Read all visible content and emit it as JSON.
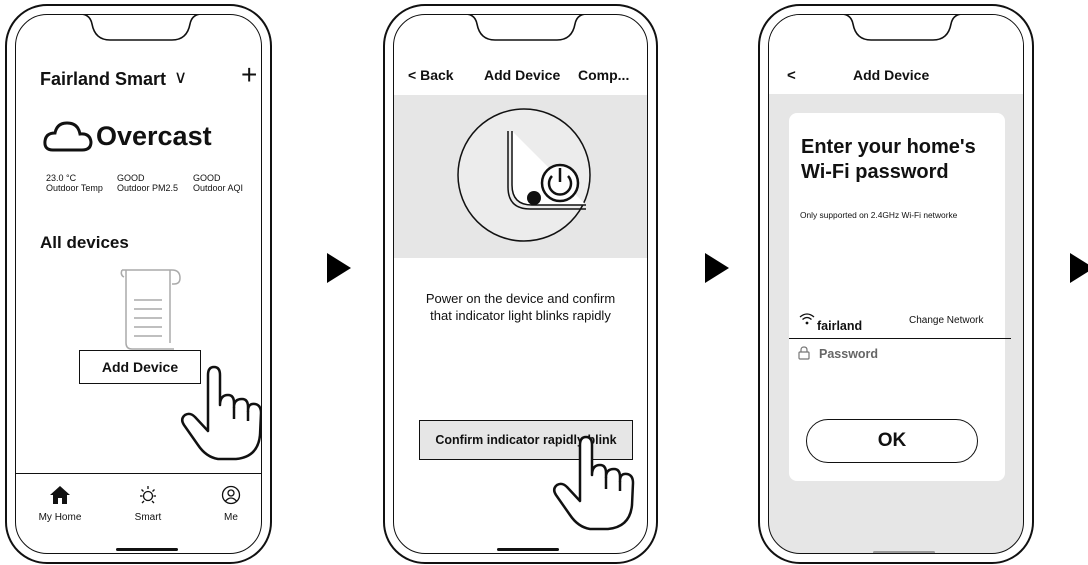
{
  "screen1": {
    "home_name": "Fairland Smart",
    "dropdown_glyph": "∨",
    "add_glyph": "+",
    "weather": "Overcast",
    "stats": [
      {
        "value": "23.0 °C",
        "label": "Outdoor Temp"
      },
      {
        "value": "GOOD",
        "label": "Outdoor PM2.5"
      },
      {
        "value": "GOOD",
        "label": "Outdoor AQI"
      }
    ],
    "section_title": "All devices",
    "add_device_label": "Add Device",
    "tabs": [
      {
        "label": "My Home",
        "icon": "home-icon"
      },
      {
        "label": "Smart",
        "icon": "sun-icon"
      },
      {
        "label": "Me",
        "icon": "user-icon"
      }
    ]
  },
  "screen2": {
    "back_label": "Back",
    "title": "Add Device",
    "complete_label": "Comp...",
    "instruction_line1": "Power on the device and confirm",
    "instruction_line2": "that indicator light blinks rapidly",
    "confirm_label": "Confirm indicator rapidly blink"
  },
  "screen3": {
    "back_glyph": "<",
    "title": "Add Device",
    "heading_line1": "Enter your home's",
    "heading_line2": "Wi-Fi password",
    "note": "Only supported on 2.4GHz Wi-Fi networke",
    "network_name": "fairland",
    "change_network_label": "Change Network",
    "password_placeholder": "Password",
    "ok_label": "OK"
  },
  "colors": {
    "line": "#111111",
    "panel_gray": "#e6e6e6",
    "bg": "#ffffff"
  }
}
